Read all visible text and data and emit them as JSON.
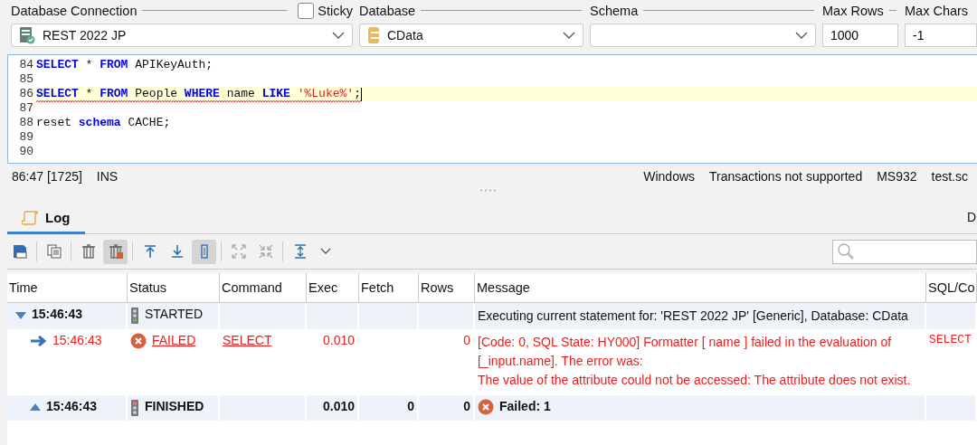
{
  "connection_bar": {
    "connection_label": "Database Connection",
    "sticky": {
      "label": "Sticky",
      "checked": false
    },
    "database_label": "Database",
    "schema_label": "Schema",
    "max_rows_label": "Max Rows",
    "max_chars_label": "Max Chars",
    "connection": "REST 2022 JP",
    "database": "CData",
    "max_rows": "1000",
    "max_chars": "-1"
  },
  "editor": {
    "lines": [
      {
        "number": "84",
        "current": false,
        "error": false,
        "tokens": [
          {
            "kind": "keyword",
            "text": "SELECT"
          },
          {
            "kind": "plain",
            "text": " * "
          },
          {
            "kind": "keyword",
            "text": "FROM"
          },
          {
            "kind": "plain",
            "text": " APIKeyAuth;"
          }
        ]
      },
      {
        "number": "85",
        "current": false
      },
      {
        "number": "86",
        "current": true,
        "error": true,
        "tokens": [
          {
            "kind": "keyword",
            "text": "SELECT"
          },
          {
            "kind": "plain",
            "text": " * "
          },
          {
            "kind": "keyword",
            "text": "FROM"
          },
          {
            "kind": "plain",
            "text": " People "
          },
          {
            "kind": "keyword",
            "text": "WHERE"
          },
          {
            "kind": "plain",
            "text": " name "
          },
          {
            "kind": "keyword",
            "text": "LIKE"
          },
          {
            "kind": "string",
            "text": " '%Luke%'"
          },
          {
            "kind": "plain",
            "text": ";"
          }
        ]
      },
      {
        "number": "87",
        "current": false
      },
      {
        "number": "88",
        "current": false,
        "error": false,
        "tokens": [
          {
            "kind": "plain",
            "text": "reset "
          },
          {
            "kind": "keyword",
            "text": "schema"
          },
          {
            "kind": "plain",
            "text": " CACHE;"
          }
        ]
      },
      {
        "number": "89",
        "current": false
      },
      {
        "number": "90",
        "current": false
      }
    ]
  },
  "status_bar": {
    "position": "86:47 [1725]",
    "mode": "INS",
    "items": [
      "Windows",
      "Transactions not supported",
      "MS932",
      "test.sc"
    ]
  },
  "log_panel": {
    "tab": {
      "label": "Log",
      "selected": true
    },
    "right_tab": "D",
    "toolbar": [
      {
        "kind": "save",
        "pressed": false
      },
      {
        "kind": "copy",
        "pressed": false
      },
      {
        "kind": "clear",
        "pressed": false
      },
      {
        "kind": "clear-all",
        "pressed": true
      },
      {
        "kind": "top",
        "pressed": false
      },
      {
        "kind": "bottom",
        "pressed": false
      },
      {
        "kind": "follow",
        "pressed": true
      },
      {
        "kind": "expand",
        "pressed": false
      },
      {
        "kind": "collapse",
        "pressed": false
      },
      {
        "kind": "fit",
        "pressed": false
      }
    ],
    "columns": [
      "Time",
      "Status",
      "Command",
      "Exec",
      "Fetch",
      "Rows",
      "Message",
      "SQL/Co"
    ],
    "rows": [
      {
        "kind": "started",
        "expanded": true,
        "time": "15:46:43",
        "status": "STARTED",
        "message": [
          "Executing current statement for: 'REST 2022 JP' [Generic], Database: CData"
        ]
      },
      {
        "kind": "failed",
        "time": "15:46:43",
        "status": "FAILED",
        "command": "SELECT",
        "exec": "0.010",
        "rows": "0",
        "message": [
          "[Code: 0, SQL State: HY000]  Formatter [ name ] failed in the evaluation of [_input.name]. The error was:",
          "The value of the attribute could not be accessed: The attribute does not exist."
        ],
        "sql": "SELECT"
      },
      {
        "kind": "finished",
        "expanded": true,
        "time": "15:46:43",
        "status": "FINISHED",
        "exec": "0.010",
        "fetch": "0",
        "rows": "0",
        "message": [
          "Failed: 1"
        ]
      }
    ]
  }
}
